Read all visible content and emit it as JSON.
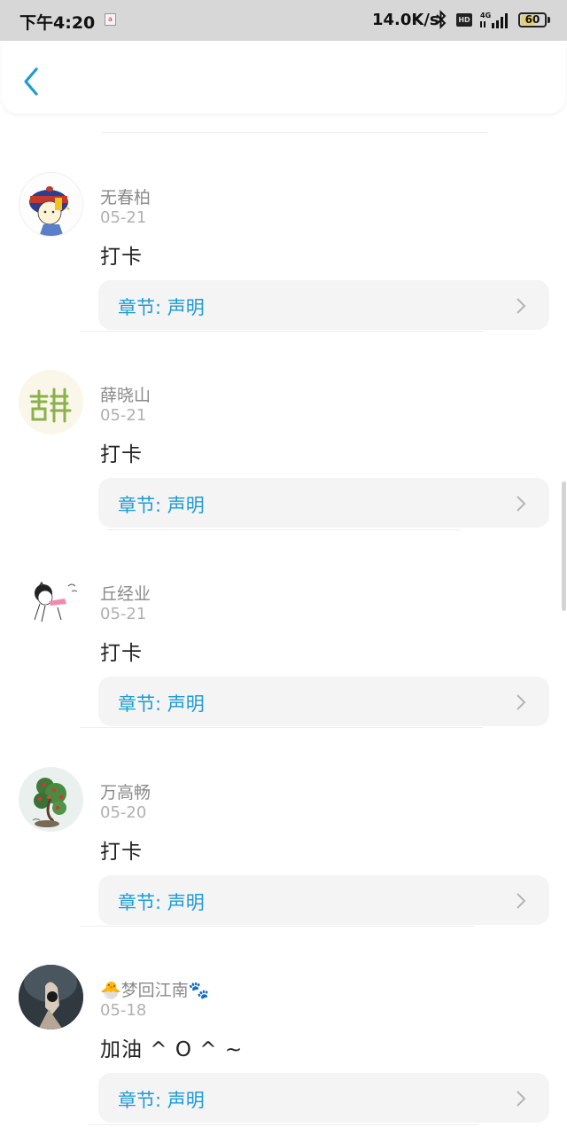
{
  "status_bar": {
    "time": "下午4:20",
    "net_speed": "14.0K/s",
    "hd": "HD",
    "network": "4G",
    "battery": "60",
    "battery_level": 0.6
  },
  "header": {
    "back_icon": "chevron-left-icon"
  },
  "comments": [
    {
      "name": "无春柏",
      "date": "05-21",
      "content": "打卡",
      "chapter": "章节: 声明",
      "avatar": "cartoon-official-avatar"
    },
    {
      "name": "薛晓山",
      "date": "05-21",
      "content": "打卡",
      "chapter": "章节: 声明",
      "avatar": "green-calligraphy-avatar"
    },
    {
      "name": "丘经业",
      "date": "05-21",
      "content": "打卡",
      "chapter": "章节: 声明",
      "avatar": "sketch-girl-avatar"
    },
    {
      "name": "万高畅",
      "date": "05-20",
      "content": "打卡",
      "chapter": "章节: 声明",
      "avatar": "bonsai-tree-avatar"
    },
    {
      "name": "🐣梦回江南🐾",
      "date": "05-18",
      "content": "加油 ^ O ^ ~",
      "chapter": "章节: 声明",
      "avatar": "photo-avatar"
    }
  ],
  "colors": {
    "accent": "#1e9ad6",
    "status_bar_bg": "#d7d7d7",
    "chapter_bg": "#f4f4f4"
  }
}
